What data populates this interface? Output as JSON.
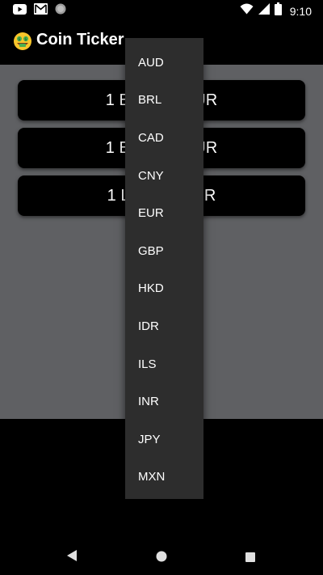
{
  "status_bar": {
    "time": "9:10",
    "icons": [
      "youtube-icon",
      "gmail-icon",
      "circle-notification-icon",
      "wifi-icon",
      "signal-icon",
      "battery-icon"
    ]
  },
  "app_bar": {
    "emoji_icon": "money-mouth-face-icon",
    "title": "Coin Ticker"
  },
  "rates": [
    {
      "label": "1 BTC = ? EUR"
    },
    {
      "label": "1 ETH = ? EUR"
    },
    {
      "label": "1 LTC = ? EUR"
    }
  ],
  "dropdown": {
    "options": [
      "AUD",
      "BRL",
      "CAD",
      "CNY",
      "EUR",
      "GBP",
      "HKD",
      "IDR",
      "ILS",
      "INR",
      "JPY",
      "MXN"
    ]
  },
  "nav_bar": {
    "icons": [
      "back-icon",
      "home-icon",
      "recents-icon"
    ]
  },
  "colors": {
    "background": "#000000",
    "content": "#5f6063",
    "dropdown": "#2d2d2d",
    "text": "#ffffff"
  }
}
